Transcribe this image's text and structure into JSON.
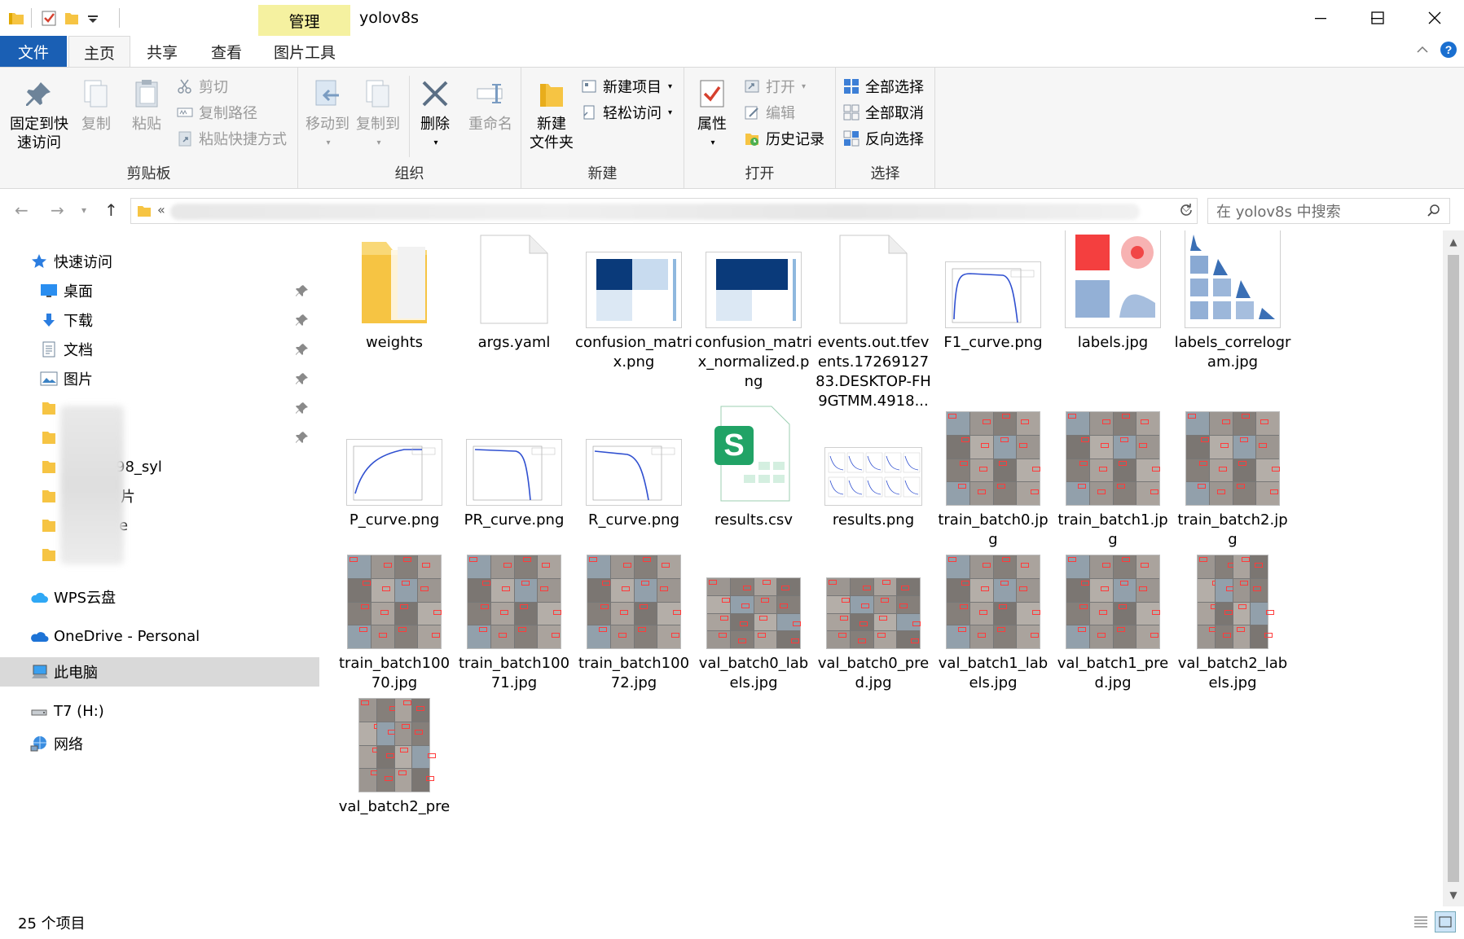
{
  "window": {
    "title": "yolov8s",
    "context_tab": "管理",
    "minimize_label": "minimize",
    "maximize_label": "maximize",
    "close_label": "close"
  },
  "tabs": {
    "file": "文件",
    "home": "主页",
    "share": "共享",
    "view": "查看",
    "picture_tools": "图片工具"
  },
  "ribbon": {
    "clipboard": {
      "label": "剪贴板",
      "pin": "固定到快速访问",
      "pin_l1": "固定到快",
      "pin_l2": "速访问",
      "copy": "复制",
      "paste": "粘贴",
      "cut": "剪切",
      "copy_path": "复制路径",
      "paste_shortcut": "粘贴快捷方式"
    },
    "organize": {
      "label": "组织",
      "move_to": "移动到",
      "copy_to": "复制到",
      "delete": "删除",
      "rename": "重命名"
    },
    "new": {
      "label": "新建",
      "new_folder_l1": "新建",
      "new_folder_l2": "文件夹",
      "new_item": "新建项目",
      "easy_access": "轻松访问"
    },
    "open": {
      "label": "打开",
      "properties": "属性",
      "open": "打开",
      "edit": "编辑",
      "history": "历史记录"
    },
    "select": {
      "label": "选择",
      "select_all": "全部选择",
      "select_none": "全部取消",
      "invert": "反向选择"
    }
  },
  "address": {
    "chevron": "«",
    "search_placeholder": "在 yolov8s 中搜索"
  },
  "nav": {
    "quick_access": "快速访问",
    "desktop": "桌面",
    "downloads": "下载",
    "documents": "文档",
    "pictures": "图片",
    "partial_1": "98_syl",
    "partial_2": "片",
    "partial_3": "e",
    "wps": "WPS云盘",
    "onedrive": "OneDrive - Personal",
    "this_pc": "此电脑",
    "t7": "T7 (H:)",
    "network": "网络"
  },
  "files": [
    {
      "name": "weights",
      "kind": "folder"
    },
    {
      "name": "args.yaml",
      "kind": "doc"
    },
    {
      "name": "confusion_matrix.png",
      "kind": "cm"
    },
    {
      "name": "confusion_matrix_normalized.png",
      "kind": "cmn"
    },
    {
      "name": "events.out.tfevents.1726912783.DESKTOP-FH9GTMM.4918...",
      "kind": "doc"
    },
    {
      "name": "F1_curve.png",
      "kind": "curve-f1"
    },
    {
      "name": "labels.jpg",
      "kind": "labels"
    },
    {
      "name": "labels_correlogram.jpg",
      "kind": "correlogram"
    },
    {
      "name": "P_curve.png",
      "kind": "curve-p"
    },
    {
      "name": "PR_curve.png",
      "kind": "curve-pr"
    },
    {
      "name": "R_curve.png",
      "kind": "curve-r"
    },
    {
      "name": "results.csv",
      "kind": "csv"
    },
    {
      "name": "results.png",
      "kind": "results"
    },
    {
      "name": "train_batch0.jpg",
      "kind": "batch"
    },
    {
      "name": "train_batch1.jpg",
      "kind": "batch"
    },
    {
      "name": "train_batch2.jpg",
      "kind": "batch"
    },
    {
      "name": "train_batch10070.jpg",
      "kind": "batch"
    },
    {
      "name": "train_batch10071.jpg",
      "kind": "batch"
    },
    {
      "name": "train_batch10072.jpg",
      "kind": "batch"
    },
    {
      "name": "val_batch0_labels.jpg",
      "kind": "batchw"
    },
    {
      "name": "val_batch0_pred.jpg",
      "kind": "batchw"
    },
    {
      "name": "val_batch1_labels.jpg",
      "kind": "batch"
    },
    {
      "name": "val_batch1_pred.jpg",
      "kind": "batch"
    },
    {
      "name": "val_batch2_labels.jpg",
      "kind": "batchn"
    },
    {
      "name": "val_batch2_pre",
      "kind": "batchn"
    }
  ],
  "status": {
    "count": "25 个项目"
  },
  "colors": {
    "accent": "#1a5fb4",
    "manage_tab": "#f5f1a0",
    "folder": "#f6c443"
  }
}
